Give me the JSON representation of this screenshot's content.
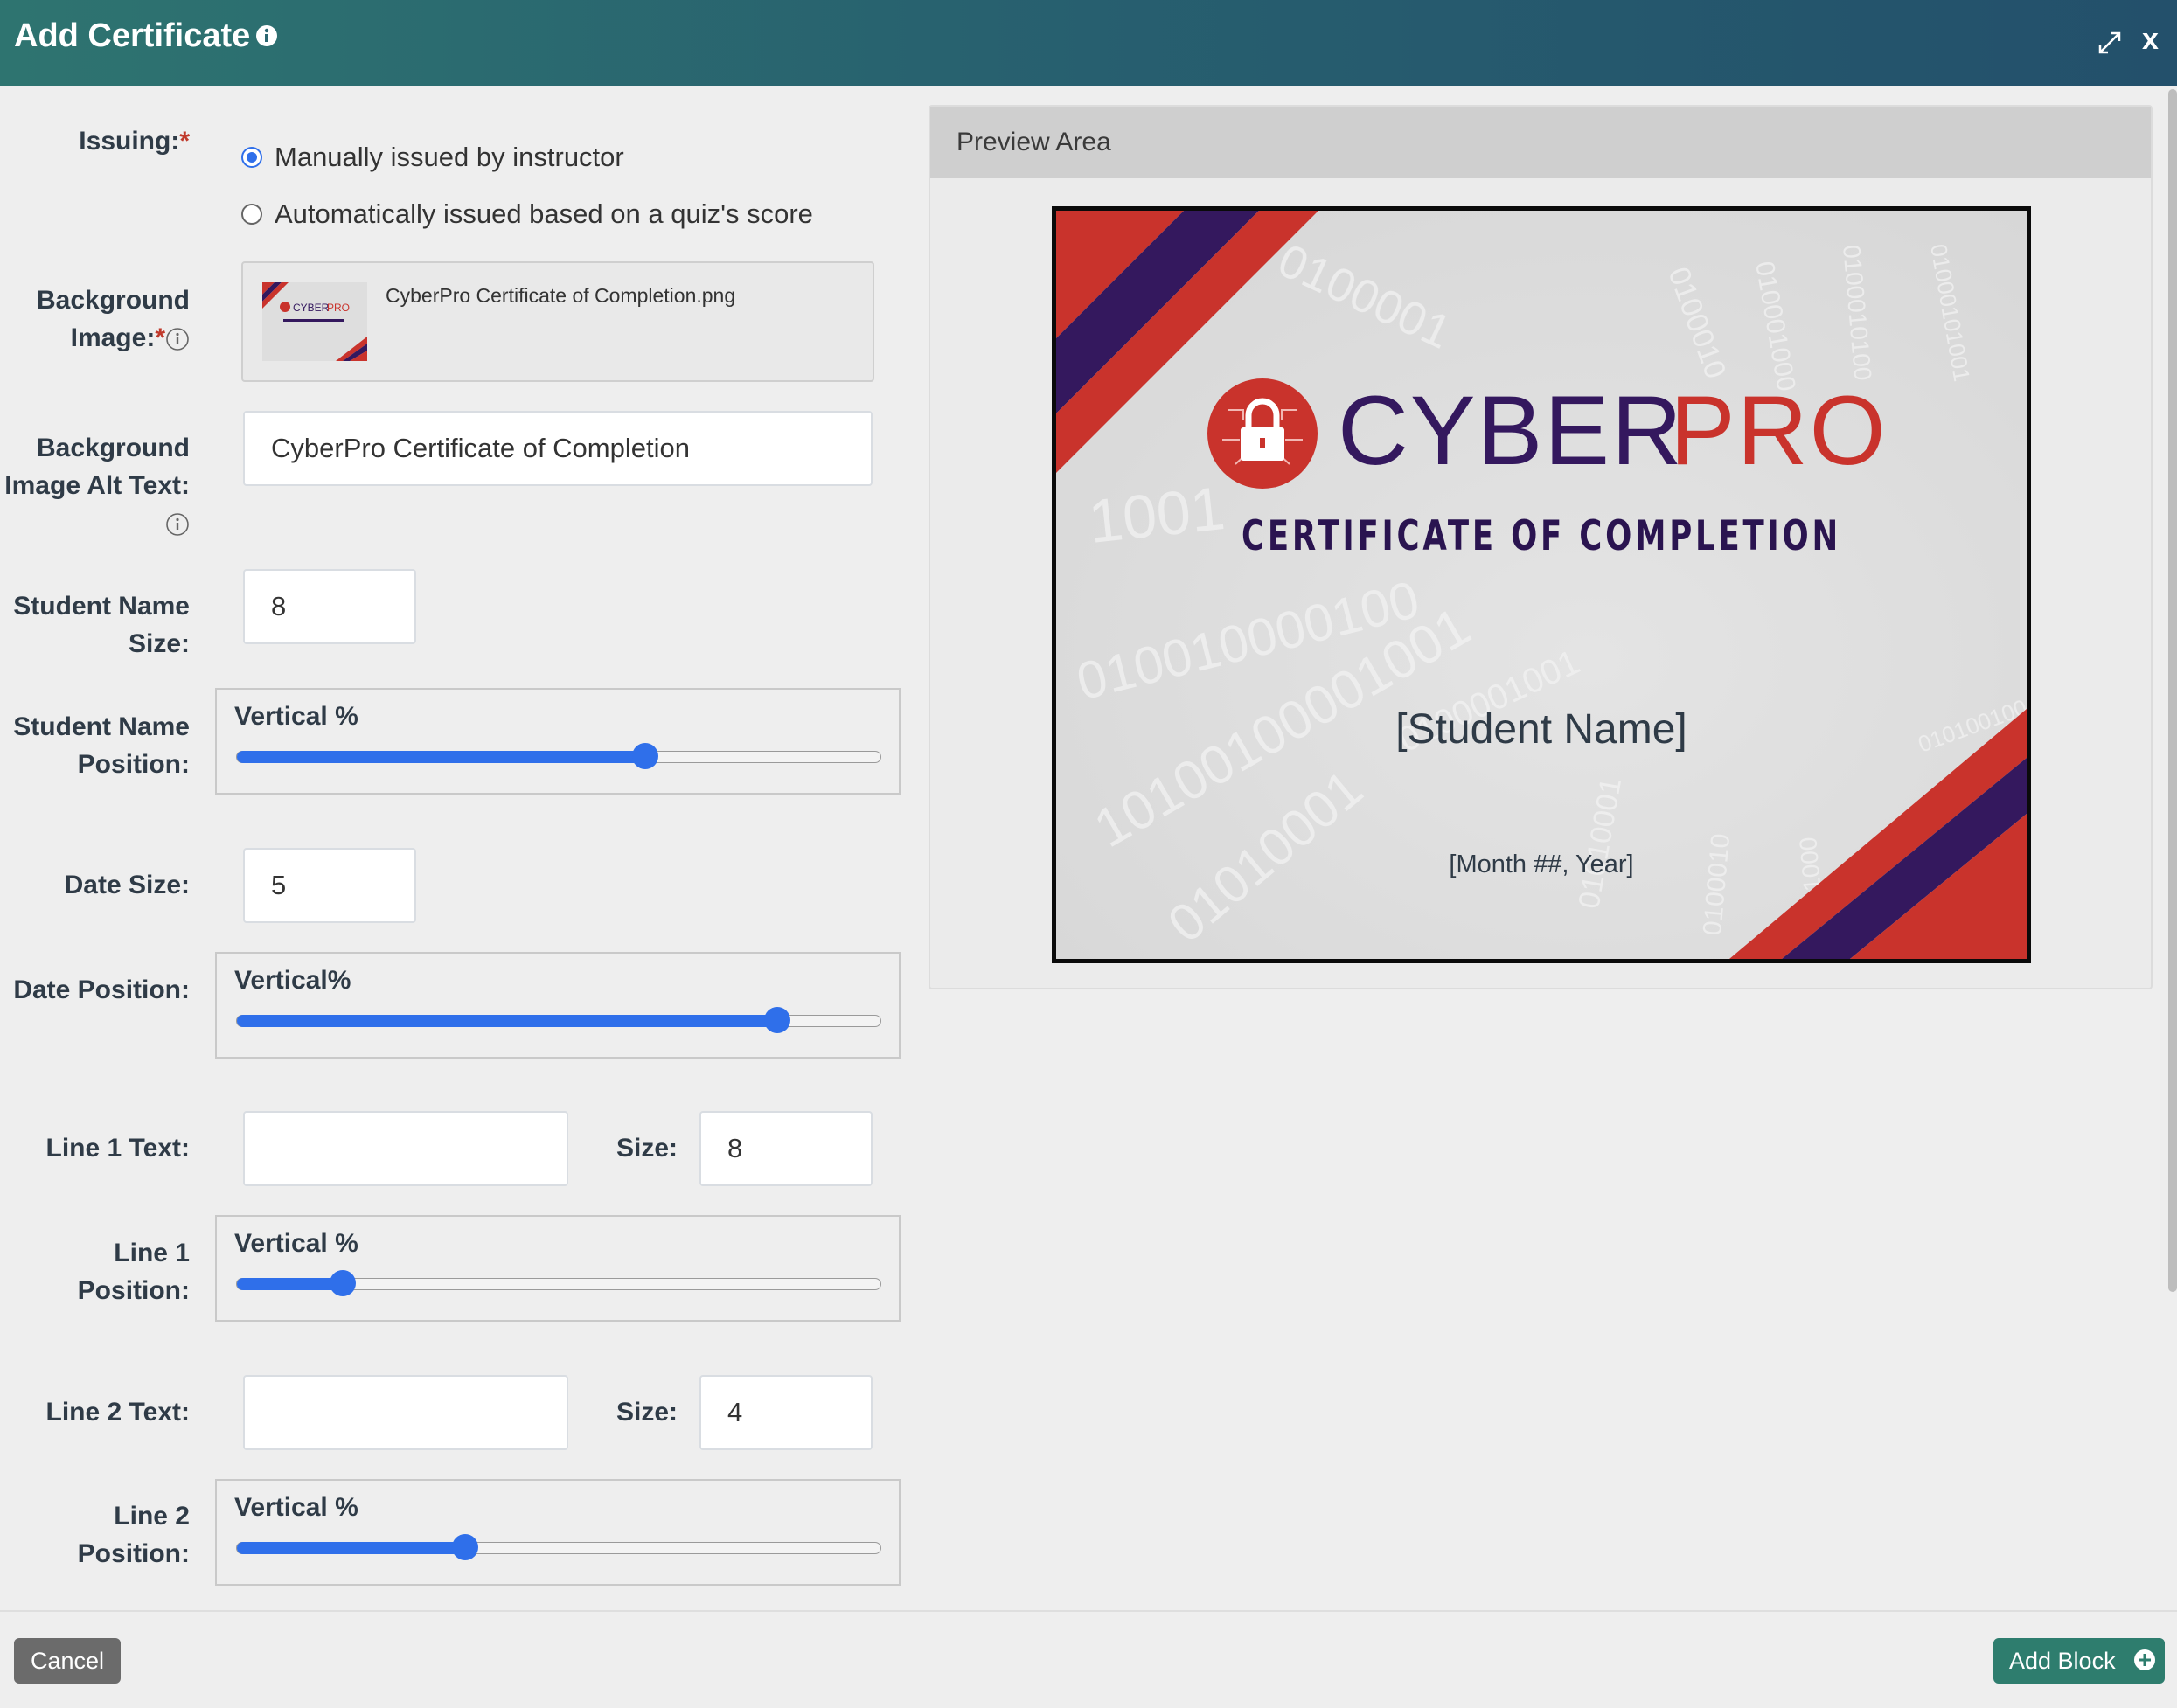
{
  "header": {
    "title": "Add Certificate"
  },
  "form": {
    "issuing": {
      "label": "Issuing:",
      "options": [
        {
          "label": "Manually issued by instructor",
          "checked": true
        },
        {
          "label": "Automatically issued based on a quiz's score",
          "checked": false
        }
      ]
    },
    "background_image": {
      "label_line1": "Background",
      "label_line2": "Image:",
      "file_name": "CyberPro Certificate of Completion.png"
    },
    "alt_text": {
      "label_line1": "Background",
      "label_line2": "Image Alt Text:",
      "value": "CyberPro Certificate of Completion"
    },
    "student_name_size": {
      "label_line1": "Student Name",
      "label_line2": "Size:",
      "value": "8"
    },
    "student_name_position": {
      "label_line1": "Student Name",
      "label_line2": "Position:",
      "slider_label": "Vertical %",
      "value_fraction": 0.635
    },
    "date_size": {
      "label": "Date Size:",
      "value": "5"
    },
    "date_position": {
      "label": "Date Position:",
      "slider_label": "Vertical%",
      "value_fraction": 0.84
    },
    "line1_text": {
      "label": "Line 1 Text:",
      "value": "",
      "size_label": "Size:",
      "size_value": "8"
    },
    "line1_position": {
      "label_line1": "Line 1",
      "label_line2": "Position:",
      "slider_label": "Vertical %",
      "value_fraction": 0.165
    },
    "line2_text": {
      "label": "Line 2 Text:",
      "value": "",
      "size_label": "Size:",
      "size_value": "4"
    },
    "line2_position": {
      "label_line1": "Line 2",
      "label_line2": "Position:",
      "slider_label": "Vertical %",
      "value_fraction": 0.355
    }
  },
  "preview": {
    "title": "Preview Area",
    "brand_cyber": "CYBER",
    "brand_pro": "PRO",
    "subtitle": "CERTIFICATE OF COMPLETION",
    "student_placeholder": "[Student Name]",
    "date_placeholder": "[Month ##, Year]"
  },
  "footer": {
    "cancel_label": "Cancel",
    "add_label": "Add Block"
  },
  "colors": {
    "header": "#2e7470",
    "accent": "#2f6fea",
    "add_button": "#2e7d6e",
    "brand_red": "#c9332c",
    "brand_purple": "#34185e"
  }
}
